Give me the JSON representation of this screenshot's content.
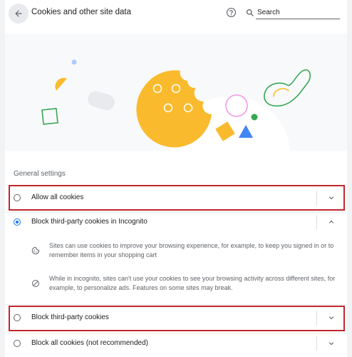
{
  "header": {
    "title": "Cookies and other site data",
    "search_placeholder": "Search"
  },
  "icons": {
    "back": "back-arrow-icon",
    "help": "help-circle-icon",
    "search": "search-icon",
    "cookie": "cookie-icon",
    "block": "block-icon",
    "chevron_down": "chevron-down-icon",
    "chevron_up": "chevron-up-icon"
  },
  "general_settings": {
    "heading": "General settings",
    "options": [
      {
        "label": "Allow all cookies",
        "selected": false,
        "expanded": false,
        "highlighted": true
      },
      {
        "label": "Block third-party cookies in Incognito",
        "selected": true,
        "expanded": true,
        "highlighted": false,
        "details": [
          "Sites can use cookies to improve your browsing experience, for example, to keep you signed in or to remember items in your shopping cart",
          "While in incognito, sites can't use your cookies to see your browsing activity across different sites, for example, to personalize ads. Features on some sites may break."
        ]
      },
      {
        "label": "Block third-party cookies",
        "selected": false,
        "expanded": false,
        "highlighted": true
      },
      {
        "label": "Block all cookies (not recommended)",
        "selected": false,
        "expanded": false,
        "highlighted": false
      }
    ]
  },
  "colors": {
    "accent": "#1a73e8",
    "highlight_box": "#c1272d",
    "cookie_yellow": "#f9bb2d",
    "green": "#34a853",
    "pink": "#f199e6",
    "blue": "#4285f4"
  }
}
